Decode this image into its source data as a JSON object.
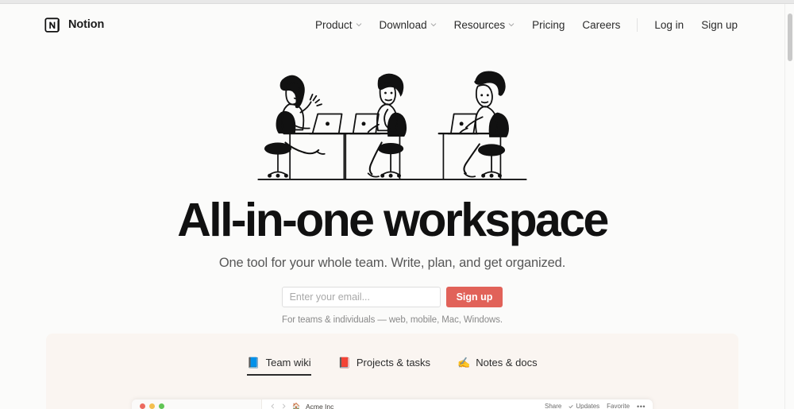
{
  "brand": {
    "name": "Notion",
    "logo_icon": "notion-n-logo"
  },
  "nav": {
    "items": [
      {
        "label": "Product",
        "has_dropdown": true,
        "icon": "chevron-down-icon"
      },
      {
        "label": "Download",
        "has_dropdown": true,
        "icon": "chevron-down-icon"
      },
      {
        "label": "Resources",
        "has_dropdown": true,
        "icon": "chevron-down-icon"
      },
      {
        "label": "Pricing",
        "has_dropdown": false,
        "icon": ""
      },
      {
        "label": "Careers",
        "has_dropdown": false,
        "icon": ""
      }
    ],
    "auth": [
      {
        "label": "Log in"
      },
      {
        "label": "Sign up"
      }
    ]
  },
  "hero": {
    "illustration_icon": "three-people-at-desks-illustration",
    "headline": "All-in-one workspace",
    "subhead": "One tool for your whole team. Write, plan, and get organized.",
    "form": {
      "email_placeholder": "Enter your email...",
      "email_value": "",
      "submit_label": "Sign up",
      "note": "For teams & individuals — web, mobile, Mac, Windows."
    }
  },
  "tabs": [
    {
      "emoji": "📘",
      "icon": "blue-book-icon",
      "label": "Team wiki",
      "active": true
    },
    {
      "emoji": "📕",
      "icon": "red-book-icon",
      "label": "Projects & tasks",
      "active": false
    },
    {
      "emoji": "✍️",
      "icon": "writing-hand-icon",
      "label": "Notes & docs",
      "active": false
    }
  ],
  "mockup": {
    "window_controls": [
      "close",
      "minimize",
      "zoom"
    ],
    "back_icon": "back-arrow-icon",
    "forward_icon": "forward-arrow-icon",
    "page_emoji": "🏠",
    "title": "Acme Inc",
    "actions": [
      {
        "label": "Share",
        "icon": ""
      },
      {
        "label": "Updates",
        "icon": "check-icon"
      },
      {
        "label": "Favorite",
        "icon": ""
      }
    ],
    "more_label": "•••"
  },
  "colors": {
    "accent_red": "#e16259",
    "page_bg": "#fbfbfa",
    "cream_panel": "#faf5f1",
    "text_dark": "#111111"
  },
  "scrollbar": {
    "visible": true
  }
}
